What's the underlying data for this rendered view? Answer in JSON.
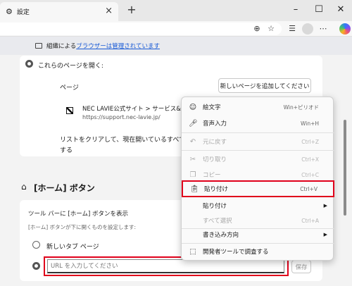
{
  "tab": {
    "title": "設定"
  },
  "info_bar": {
    "prefix": "組織による",
    "link": "ブラウザーは管理されています"
  },
  "startup": {
    "radio_label": "これらのページを開く:",
    "pages_heading": "ページ",
    "add_page_button": "新しいページを追加してください",
    "page_title": "NEC LAVIE公式サイト > サービス&",
    "page_url": "https://support.nec-lavie.jp/",
    "clear_text_line1": "リストをクリアして、現在開いているすべての",
    "clear_text_line2": "する"
  },
  "home": {
    "section_title": "[ホーム] ボタン",
    "toggle_label": "ツール バーに [ホーム] ボタンを表示",
    "description": "[ホーム] ボタンが下に開くものを設定します:",
    "option_newtab": "新しいタブ ページ",
    "url_placeholder": "URL を入力してください",
    "save_button": "保存"
  },
  "context_menu": {
    "items": [
      {
        "label": "絵文字",
        "shortcut": "Win+ピリオド",
        "icon": "emoji-icon",
        "disabled": false
      },
      {
        "label": "音声入力",
        "shortcut": "Win+H",
        "icon": "microphone-icon",
        "disabled": false
      },
      {
        "label": "元に戻す",
        "shortcut": "Ctrl+Z",
        "icon": "undo-icon",
        "disabled": true
      },
      {
        "label": "切り取り",
        "shortcut": "Ctrl+X",
        "icon": "cut-icon",
        "disabled": true
      },
      {
        "label": "コピー",
        "shortcut": "Ctrl+C",
        "icon": "copy-icon",
        "disabled": true
      },
      {
        "label": "貼り付け",
        "shortcut": "Ctrl+V",
        "icon": "paste-icon",
        "disabled": false
      },
      {
        "label": "貼り付け",
        "shortcut": "",
        "icon": "",
        "disabled": false
      },
      {
        "label": "すべて選択",
        "shortcut": "Ctrl+A",
        "icon": "",
        "disabled": true
      },
      {
        "label": "書き込み方向",
        "shortcut": "",
        "icon": "",
        "disabled": false
      },
      {
        "label": "開発者ツールで調査する",
        "shortcut": "",
        "icon": "inspect-icon",
        "disabled": false
      }
    ]
  },
  "colors": {
    "highlight": "#e0001b",
    "link": "#1a5bd6"
  }
}
